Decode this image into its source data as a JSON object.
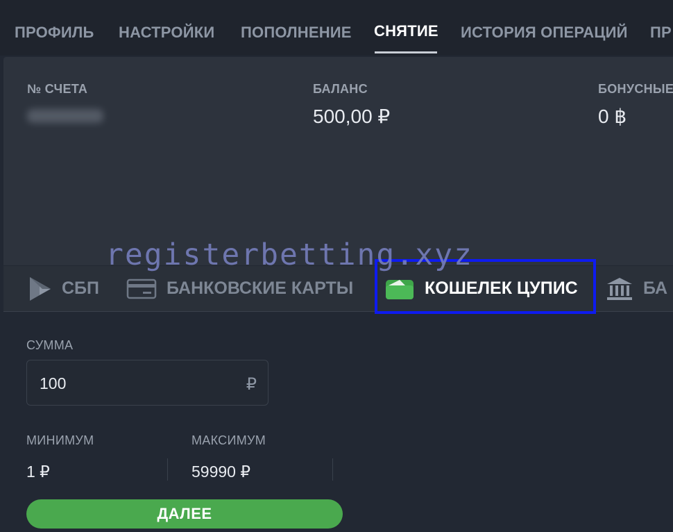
{
  "tabs": [
    {
      "label": "ПРОФИЛЬ"
    },
    {
      "label": "НАСТРОЙКИ"
    },
    {
      "label": "ПОПОЛНЕНИЕ"
    },
    {
      "label": "СНЯТИЕ",
      "active": true
    },
    {
      "label": "ИСТОРИЯ ОПЕРАЦИЙ"
    },
    {
      "label": "ПР"
    }
  ],
  "account": {
    "number_label": "№ СЧЕТА",
    "balance_label": "БАЛАНС",
    "balance_value": "500,00 ₽",
    "bonus_label": "БОНУСНЫЕ",
    "bonus_value": "0 ฿"
  },
  "methods": [
    {
      "label": "СБП",
      "icon": "sbp-icon"
    },
    {
      "label": "БАНКОВСКИЕ КАРТЫ",
      "icon": "bank-card-icon"
    },
    {
      "label": "КОШЕЛЕК ЦУПИС",
      "icon": "wallet-icon",
      "active": true
    },
    {
      "label": "БА",
      "icon": "bank-building-icon"
    }
  ],
  "watermark": "registerbetting.xyz",
  "form": {
    "amount_label": "СУММА",
    "amount_value": "100",
    "amount_currency": "₽",
    "min_label": "МИНИМУМ",
    "min_value": "1 ₽",
    "max_label": "МАКСИМУМ",
    "max_value": "59990 ₽",
    "submit_label": "ДАЛЕЕ"
  },
  "colors": {
    "background": "#222833",
    "panel": "#2d333d",
    "accent_green": "#4aa94e",
    "highlight_blue": "#0e1bf0"
  }
}
